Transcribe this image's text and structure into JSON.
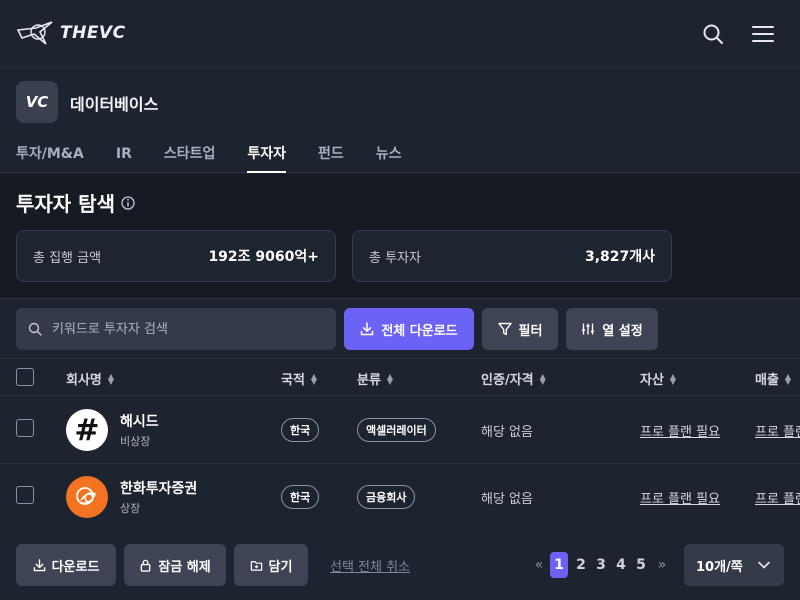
{
  "header": {
    "logo_text": "THEVC",
    "icons": [
      "search-icon",
      "menu-icon"
    ]
  },
  "subheader": {
    "badge": "VC",
    "title": "데이터베이스",
    "tabs": [
      {
        "label": "투자/M&A",
        "active": false
      },
      {
        "label": "IR",
        "active": false
      },
      {
        "label": "스타트업",
        "active": false
      },
      {
        "label": "투자자",
        "active": true
      },
      {
        "label": "펀드",
        "active": false
      },
      {
        "label": "뉴스",
        "active": false
      }
    ]
  },
  "section": {
    "title": "투자자 탐색",
    "stats": [
      {
        "label": "총 집행 금액",
        "value": "192조 9060억+"
      },
      {
        "label": "총 투자자",
        "value": "3,827개사"
      }
    ]
  },
  "toolbar": {
    "search_placeholder": "키워드로 투자자 검색",
    "download_all_label": "전체 다운로드",
    "filter_label": "필터",
    "columns_label": "열 설정"
  },
  "table": {
    "columns": [
      "회사명",
      "국적",
      "분류",
      "인증/자격",
      "자산",
      "매출"
    ],
    "rows": [
      {
        "name": "해시드",
        "status": "비상장",
        "country": "한국",
        "category": "액셀러레이터",
        "certification": "해당 없음",
        "assets": "프로 플랜 필요",
        "revenue": "프로 플랜"
      },
      {
        "name": "한화투자증권",
        "status": "상장",
        "country": "한국",
        "category": "금융회사",
        "certification": "해당 없음",
        "assets": "프로 플랜 필요",
        "revenue": "프로 플랜"
      }
    ]
  },
  "footer": {
    "download_label": "다운로드",
    "unlock_label": "잠금 해제",
    "save_label": "담기",
    "deselect_label": "선택 전체 취소",
    "pages": [
      "1",
      "2",
      "3",
      "4",
      "5"
    ],
    "current_page": "1",
    "per_page": "10개/쪽"
  },
  "colors": {
    "accent": "#6c63f6",
    "background": "#1e2330",
    "hashed_bg": "#ffffff",
    "hanwha_orange": "#f37321"
  }
}
